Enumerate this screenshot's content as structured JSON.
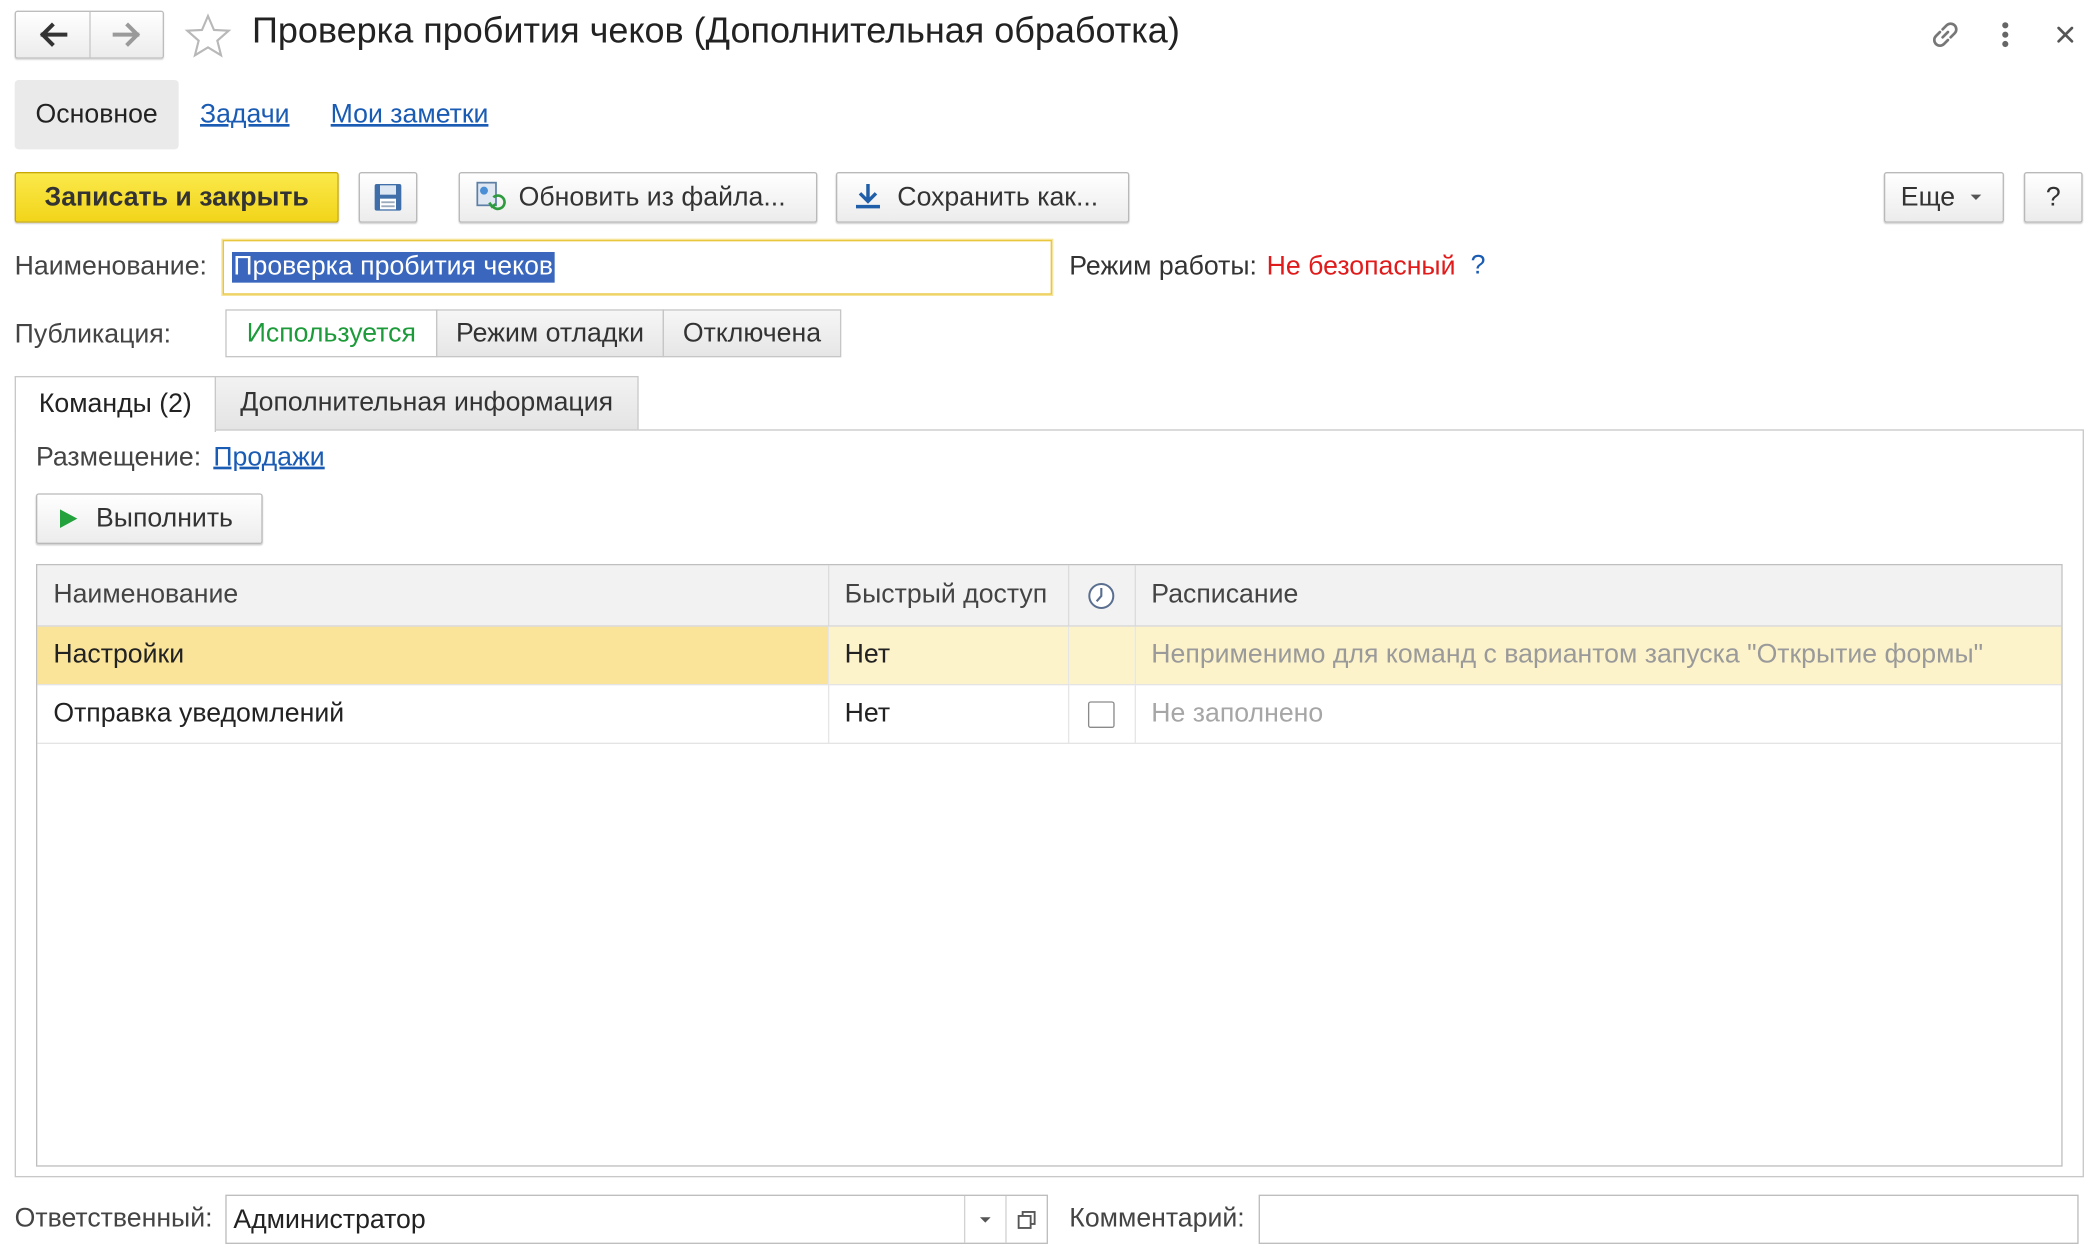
{
  "window": {
    "title": "Проверка пробития чеков (Дополнительная обработка)"
  },
  "nav_tabs": [
    {
      "label": "Основное",
      "active": true
    },
    {
      "label": "Задачи",
      "active": false
    },
    {
      "label": "Мои заметки",
      "active": false
    }
  ],
  "toolbar": {
    "save_close_label": "Записать и закрыть",
    "update_label": "Обновить из файла...",
    "save_as_label": "Сохранить как...",
    "more_label": "Еще",
    "help_label": "?"
  },
  "form": {
    "name_label": "Наименование:",
    "name_value": "Проверка пробития чеков",
    "mode_label": "Режим работы:",
    "mode_value": "Не безопасный",
    "mode_help": "?",
    "publication_label": "Публикация:",
    "publication_options": [
      "Используется",
      "Режим отладки",
      "Отключена"
    ],
    "publication_selected": "Используется"
  },
  "section_tabs": [
    {
      "label": "Команды (2)",
      "active": true
    },
    {
      "label": "Дополнительная информация",
      "active": false
    }
  ],
  "commands": {
    "placement_label": "Размещение:",
    "placement_value": "Продажи",
    "run_label": "Выполнить",
    "columns": [
      "Наименование",
      "Быстрый доступ",
      "",
      "Расписание"
    ],
    "rows": [
      {
        "name": "Настройки",
        "quick": "Нет",
        "schedule": "Неприменимо для команд с вариантом запуска \"Открытие формы\"",
        "selected": true
      },
      {
        "name": "Отправка уведомлений",
        "quick": "Нет",
        "schedule": "Не заполнено",
        "selected": false
      }
    ]
  },
  "footer": {
    "responsible_label": "Ответственный:",
    "responsible_value": "Администратор",
    "comment_label": "Комментарий:",
    "comment_value": ""
  },
  "colors": {
    "accent_yellow": "#f5dc1e",
    "danger_red": "#e01b1b",
    "success_green": "#1d9a3a",
    "link_blue": "#1a5bb4",
    "selection_yellow": "#fae49a"
  }
}
